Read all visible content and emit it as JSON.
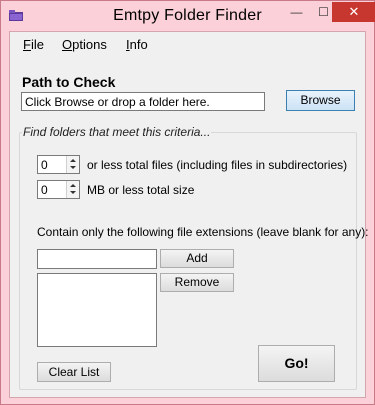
{
  "window": {
    "title": "Emtpy Folder Finder",
    "controls": {
      "minimize": "—",
      "maximize": "☐",
      "close": "✕"
    }
  },
  "menu": [
    {
      "label_prefix": "",
      "label_mnemonic": "F",
      "label_rest": "ile"
    },
    {
      "label_prefix": "",
      "label_mnemonic": "O",
      "label_rest": "ptions"
    },
    {
      "label_prefix": "",
      "label_mnemonic": "I",
      "label_rest": "nfo"
    }
  ],
  "path": {
    "heading": "Path to Check",
    "input_value": "Click Browse or drop a folder here.",
    "browse_label": "Browse"
  },
  "criteria": {
    "legend": "Find folders that meet this criteria...",
    "files_value": "0",
    "files_label": "or less total files (including files in subdirectories)",
    "size_value": "0",
    "size_label": "MB or less total size",
    "extensions_label": "Contain only the following file extensions (leave blank for any):",
    "extension_input_value": "",
    "add_label": "Add",
    "remove_label": "Remove",
    "clear_label": "Clear List",
    "go_label": "Go!"
  },
  "colors": {
    "titlebar": "#fbd0d8",
    "close_button": "#c7372f",
    "client": "#f0f0f0"
  }
}
